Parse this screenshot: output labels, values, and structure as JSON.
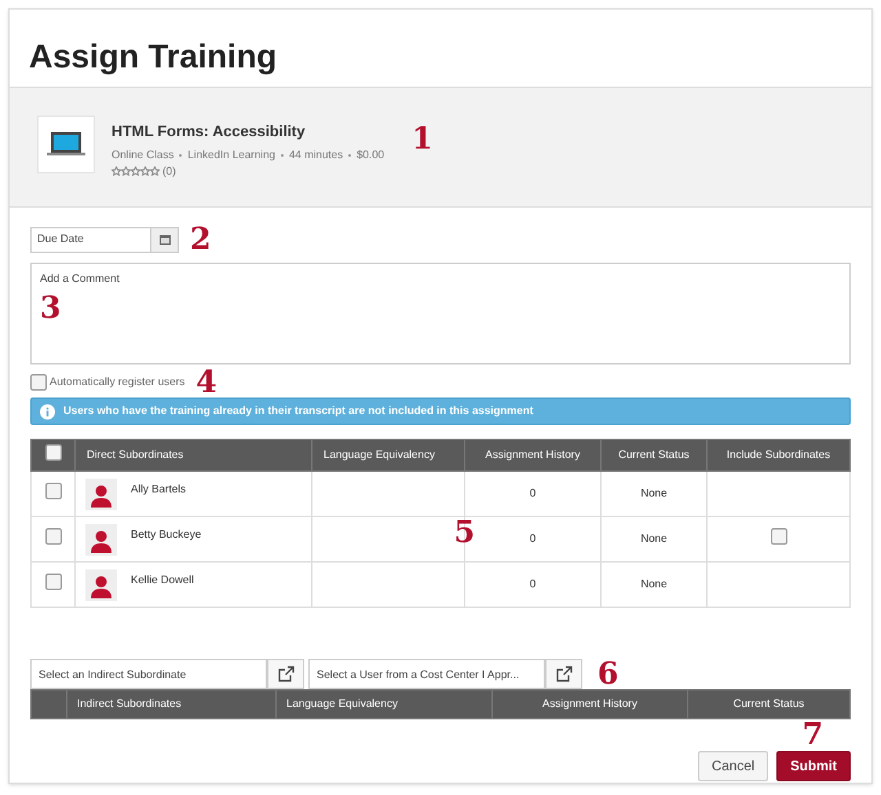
{
  "title": "Assign Training",
  "course": {
    "name": "HTML Forms: Accessibility",
    "meta": [
      "Online Class",
      "LinkedIn Learning",
      "44 minutes",
      "$0.00"
    ],
    "stars": 0,
    "rating_count": "(0)",
    "callout": "1"
  },
  "due_date": {
    "placeholder": "Due Date",
    "callout": "2"
  },
  "comment": {
    "placeholder": "Add a Comment",
    "callout": "3"
  },
  "auto_register": {
    "label": "Automatically register users",
    "checked": false,
    "callout": "4"
  },
  "info": "Users who have the training already in their transcript are not included in this assignment",
  "direct_table": {
    "select_all": false,
    "columns": [
      "Direct Subordinates",
      "Language Equivalency",
      "Assignment History",
      "Current Status",
      "Include Subordinates"
    ],
    "callout": "5",
    "rows": [
      {
        "checked": false,
        "name": "Ally Bartels",
        "history": "0",
        "status": "None",
        "include": null
      },
      {
        "checked": false,
        "name": "Betty Buckeye",
        "history": "0",
        "status": "None",
        "include": false
      },
      {
        "checked": false,
        "name": "Kellie Dowell",
        "history": "0",
        "status": "None",
        "include": null
      }
    ]
  },
  "selectors": [
    {
      "value": "Select an Indirect Subordinate"
    },
    {
      "value": "Select a User from a Cost Center I Appr..."
    }
  ],
  "selectors_callout": "6",
  "indirect_table": {
    "columns": [
      "Indirect Subordinates",
      "Language Equivalency",
      "Assignment History",
      "Current Status"
    ]
  },
  "actions_callout": "7",
  "buttons": [
    {
      "label": "Cancel",
      "kind": "secondary"
    },
    {
      "label": "Submit",
      "kind": "primary"
    }
  ]
}
